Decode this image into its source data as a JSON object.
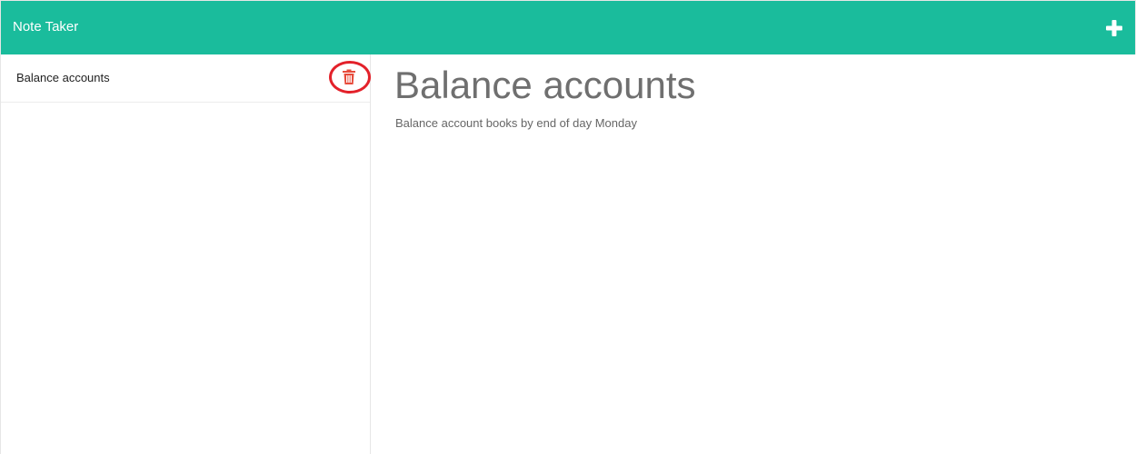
{
  "navbar": {
    "title": "Note Taker",
    "add_icon": "plus-icon",
    "background": "#1abc9c"
  },
  "sidebar": {
    "notes": [
      {
        "title": "Balance accounts",
        "delete_icon": "trash-icon"
      }
    ]
  },
  "note": {
    "title": "Balance accounts",
    "text": "Balance account books by end of day Monday"
  },
  "colors": {
    "accent": "#1abc9c",
    "delete": "#e74c3c",
    "highlight_ring": "#e3212a"
  }
}
